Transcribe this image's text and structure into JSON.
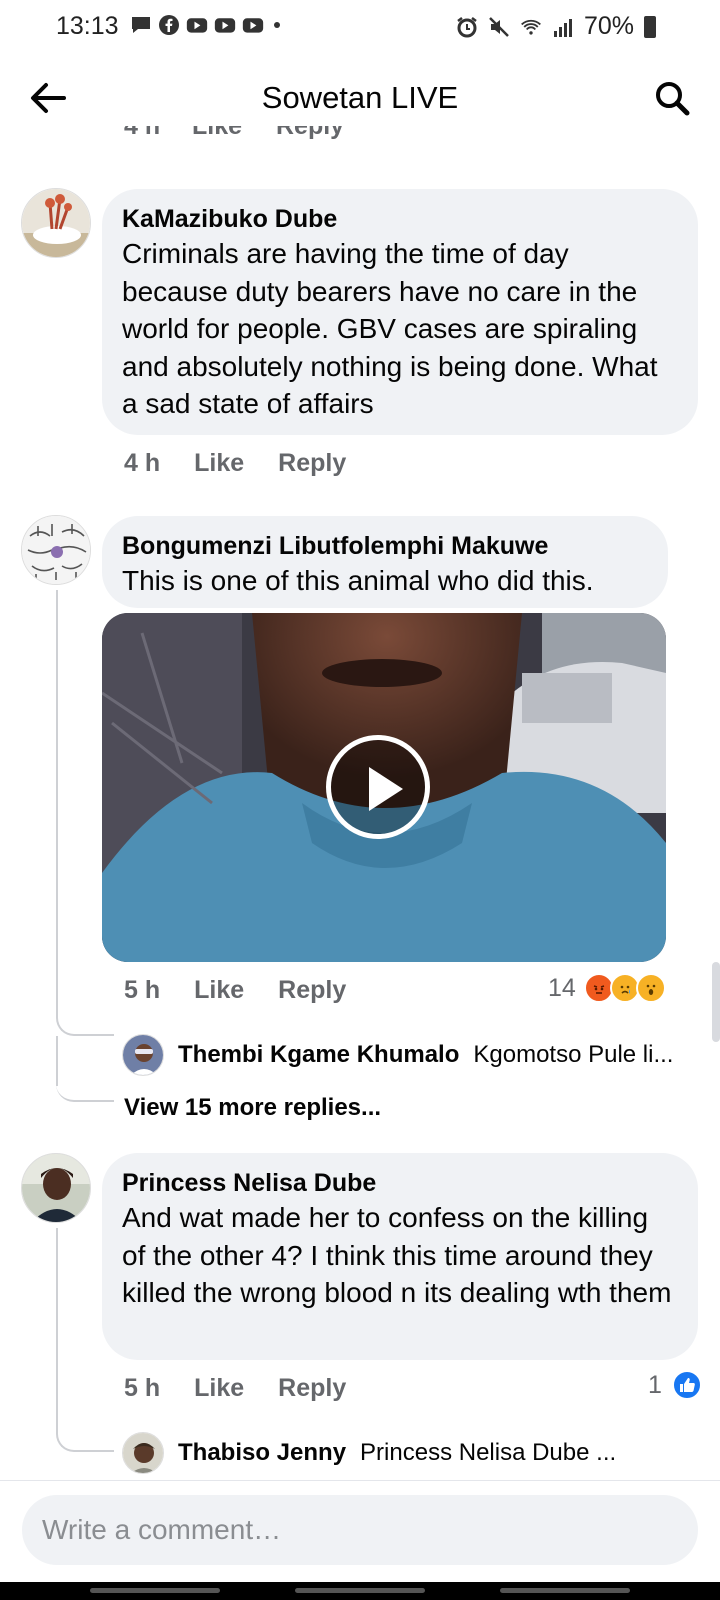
{
  "status_bar": {
    "time": "13:13",
    "battery": "70%",
    "left_icons": [
      "message-icon",
      "facebook-icon",
      "youtube-icon",
      "youtube-icon",
      "youtube-icon",
      "dot-icon"
    ],
    "right_icons": [
      "alarm-icon",
      "mute-icon",
      "wifi-icon",
      "signal-icon",
      "battery-icon"
    ]
  },
  "header": {
    "title": "Sowetan LIVE"
  },
  "comments": [
    {
      "author": "KaMazibuko Dube",
      "text": "Criminals are having the time of day because duty bearers have no care in the world for people. GBV cases are spiraling and absolutely nothing is being done. What a sad state of affairs",
      "time": "4 h",
      "like": "Like",
      "reply": "Reply"
    },
    {
      "author": "Bongumenzi Libutfolemphi Makuwe",
      "text": "This is one of this animal who did this.",
      "time": "5 h",
      "like": "Like",
      "reply": "Reply",
      "reactions_count": "14",
      "reactions": [
        "angry",
        "sad",
        "wow"
      ],
      "reply_preview": {
        "author": "Thembi Kgame Khumalo",
        "text": "Kgomotso Pule li..."
      },
      "view_more": "View 15 more replies..."
    },
    {
      "author": "Princess Nelisa Dube",
      "text": "And wat  made her to confess on the killing of the other 4? I think this time around they killed  the wrong blood n its dealing wth them",
      "time": "5 h",
      "like": "Like",
      "reply": "Reply",
      "reactions_count": "1",
      "reactions": [
        "like"
      ],
      "reply_preview": {
        "author": "Thabiso Jenny",
        "text": "Princess Nelisa Dube ..."
      }
    }
  ],
  "compose": {
    "placeholder": "Write a comment…"
  },
  "colors": {
    "bubble": "#f0f2f5",
    "meta": "#65676b",
    "like_blue": "#1877f2",
    "angry": "#f05a1e",
    "sad_wow": "#f7b125"
  }
}
